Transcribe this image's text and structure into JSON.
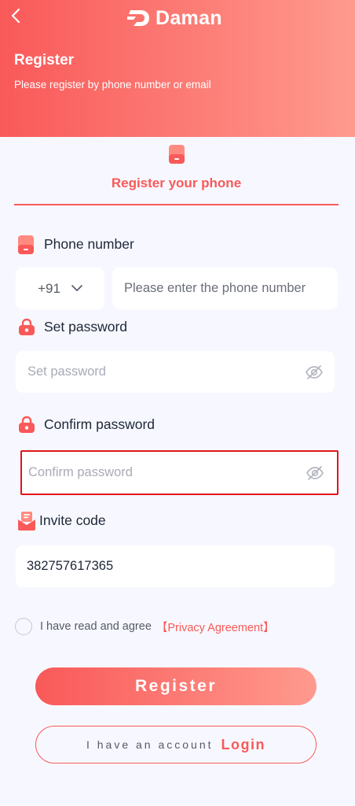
{
  "header": {
    "brand": "Daman",
    "title": "Register",
    "subtitle": "Please register by phone number or email"
  },
  "tab": {
    "label": "Register your phone"
  },
  "form": {
    "phone_label": "Phone number",
    "country_code": "+91",
    "phone_placeholder": "Please enter the phone number",
    "password_label": "Set password",
    "password_placeholder": "Set password",
    "confirm_label": "Confirm password",
    "confirm_placeholder": "Confirm password",
    "invite_label": "Invite code",
    "invite_value": "382757617365"
  },
  "agreement": {
    "text": "I have read and agree",
    "link": "【Privacy Agreement】"
  },
  "buttons": {
    "register": "Register",
    "have_account": "I have an account",
    "login": "Login"
  },
  "colors": {
    "accent": "#f95959",
    "accent_light": "#ff9a8e",
    "highlight_border": "#e0151a",
    "background": "#f7f8ff"
  },
  "icons": {
    "back": "chevron-left-icon",
    "brand": "daman-logo-icon",
    "phone": "phone-icon",
    "lock": "lock-icon",
    "eye_hidden": "eye-off-icon",
    "invite": "invite-icon",
    "dropdown": "chevron-down-icon"
  }
}
